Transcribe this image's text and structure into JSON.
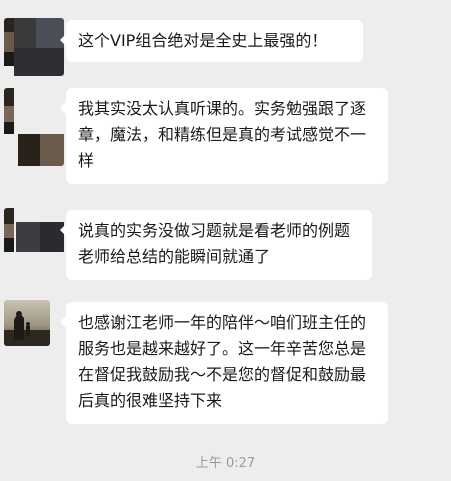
{
  "messages": [
    {
      "text": "这个VIP组合绝对是全史上最强的！"
    },
    {
      "text": "我其实没太认真听课的。实务勉强跟了逐章，魔法，和精练但是真的考试感觉不一样"
    },
    {
      "text": "说真的实务没做习题就是看老师的例题老师给总结的能瞬间就通了"
    },
    {
      "text": "也感谢江老师一年的陪伴～咱们班主任的服务也是越来越好了。这一年辛苦您总是在督促我鼓励我～不是您的督促和鼓励最后真的很难坚持下来"
    }
  ],
  "timestamp": "上午 0:27"
}
